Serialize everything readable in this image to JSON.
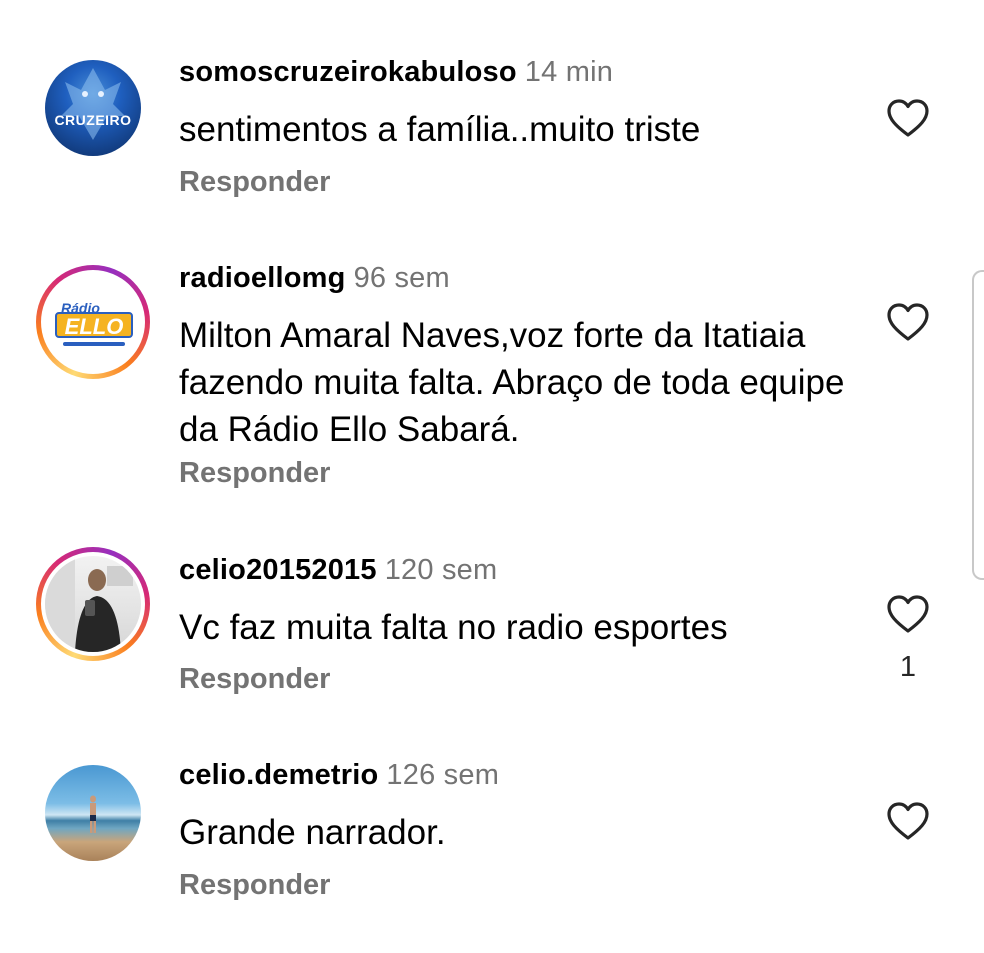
{
  "comments": [
    {
      "username": "somoscruzeirokabuloso",
      "time": "14 min",
      "text": "sentimentos a família..muito triste",
      "reply_label": "Responder",
      "likes": "",
      "avatar": {
        "label": "CRUZEIRO",
        "colors": [
          "#0b2a5e",
          "#1f5fbf"
        ]
      }
    },
    {
      "username": "radioellomg",
      "time": "96 sem",
      "text": "Milton Amaral Naves,voz forte da Itatiaia fazendo muita falta. Abraço de toda equipe da Rádio Ello Sabará.",
      "reply_label": "Responder",
      "likes": "",
      "avatar": {
        "label_top": "Rádio",
        "label_main": "ELLO",
        "colors": [
          "#2a5fbf",
          "#f5b321"
        ]
      }
    },
    {
      "username": "celio20152015",
      "time": "120 sem",
      "text": "Vc faz muita falta no radio esportes",
      "reply_label": "Responder",
      "likes": "1",
      "avatar": {
        "colors": [
          "#e9e9e9",
          "#2b2b2b"
        ]
      }
    },
    {
      "username": "celio.demetrio",
      "time": "126 sem",
      "text": "Grande narrador.",
      "reply_label": "Responder",
      "likes": "",
      "avatar": {
        "colors": [
          "#5aa7d8",
          "#b89168"
        ]
      }
    }
  ]
}
